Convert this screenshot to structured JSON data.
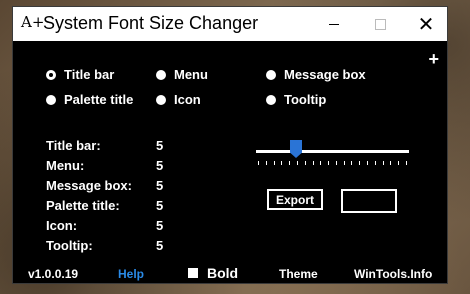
{
  "window": {
    "app_icon": "A+",
    "title": "System Font Size Changer",
    "min_icon": "minimize-icon",
    "max_icon": "maximize-icon",
    "close_icon": "close-icon"
  },
  "add_icon": "+",
  "radios": [
    {
      "label": "Title bar",
      "selected": true
    },
    {
      "label": "Menu",
      "selected": false
    },
    {
      "label": "Message box",
      "selected": false
    },
    {
      "label": "Palette title",
      "selected": false
    },
    {
      "label": "Icon",
      "selected": false
    },
    {
      "label": "Tooltip",
      "selected": false
    }
  ],
  "sizes": [
    {
      "label": "Title bar:",
      "value": "5"
    },
    {
      "label": "Menu:",
      "value": "5"
    },
    {
      "label": "Message box:",
      "value": "5"
    },
    {
      "label": "Palette title:",
      "value": "5"
    },
    {
      "label": "Icon:",
      "value": "5"
    },
    {
      "label": "Tooltip:",
      "value": "5"
    }
  ],
  "slider": {
    "ticks": 20
  },
  "buttons": {
    "export": "Export"
  },
  "footer": {
    "version": "v1.0.0.19",
    "help": "Help",
    "bold": "Bold",
    "theme": "Theme",
    "site": "WinTools.Info"
  },
  "colors": {
    "accent": "#2a74d6",
    "link": "#2a8ae6",
    "background": "#000000"
  }
}
